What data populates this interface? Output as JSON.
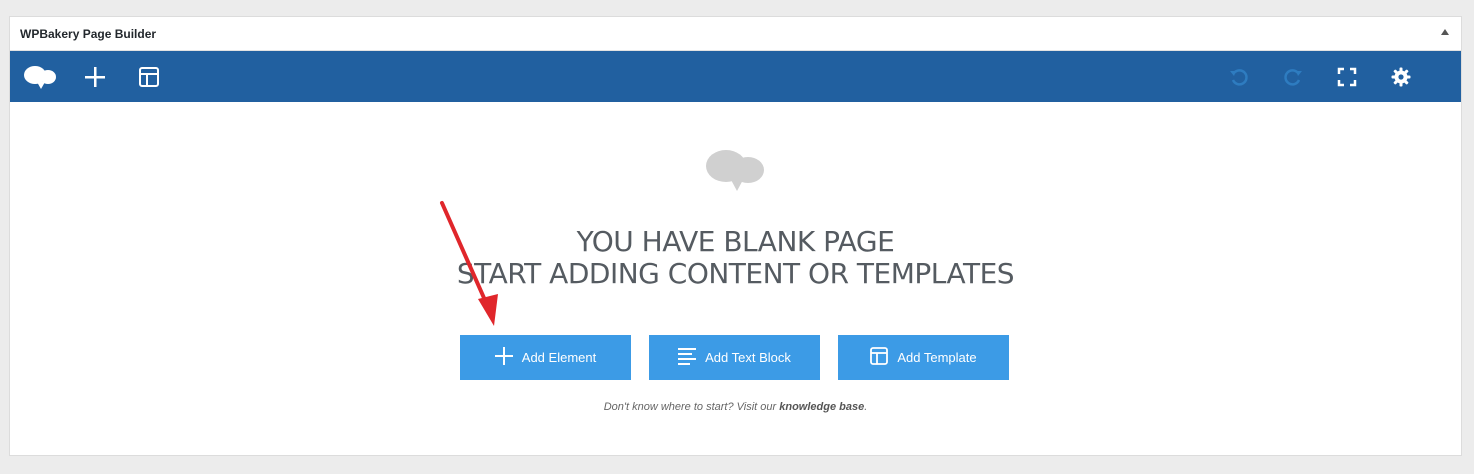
{
  "panel": {
    "title": "WPBakery Page Builder"
  },
  "toolbar": {
    "background": "#2160a0",
    "left_icons": [
      "wpbakery-logo-icon",
      "add-element-icon",
      "templates-icon"
    ],
    "right_icons": [
      "undo-icon",
      "redo-icon",
      "fullscreen-icon",
      "settings-icon"
    ]
  },
  "empty_state": {
    "line1": "YOU HAVE BLANK PAGE",
    "line2": "START ADDING CONTENT OR TEMPLATES",
    "buttons": [
      {
        "label": "Add Element",
        "icon": "plus-icon"
      },
      {
        "label": "Add Text Block",
        "icon": "text-lines-icon"
      },
      {
        "label": "Add Template",
        "icon": "template-icon"
      }
    ],
    "hint_prefix": "Don't know where to start? Visit our ",
    "hint_link": "knowledge base",
    "hint_suffix": "."
  },
  "colors": {
    "accent_button": "#3c9be6",
    "annotation_arrow": "#e0262b"
  }
}
